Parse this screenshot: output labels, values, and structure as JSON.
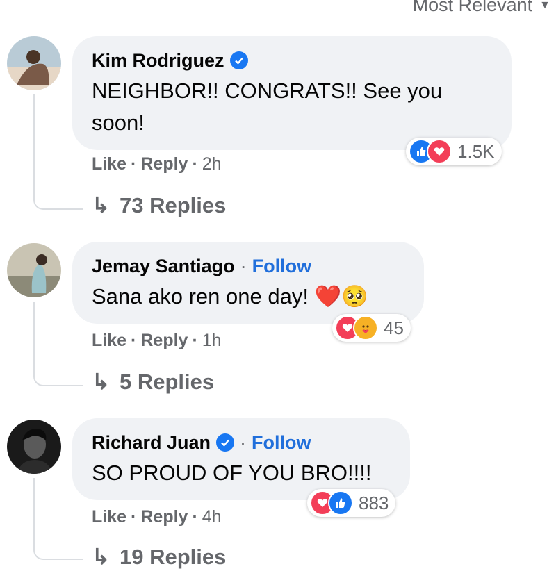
{
  "sort_label": "Most Relevant",
  "comments": [
    {
      "name": "Kim Rodriguez",
      "verified": true,
      "follow": "",
      "text": "NEIGHBOR!! CONGRATS!! See you soon!",
      "reactions": [
        "like",
        "love"
      ],
      "reaction_count": "1.5K",
      "like": "Like",
      "reply": "Reply",
      "time": "2h",
      "replies": "73 Replies"
    },
    {
      "name": "Jemay Santiago",
      "verified": false,
      "follow": "Follow",
      "text": "Sana ako ren one day! ❤️🥺",
      "reactions": [
        "love",
        "care"
      ],
      "reaction_count": "45",
      "like": "Like",
      "reply": "Reply",
      "time": "1h",
      "replies": "5 Replies"
    },
    {
      "name": "Richard Juan",
      "verified": true,
      "follow": "Follow",
      "text": "SO PROUD OF YOU BRO!!!!",
      "reactions": [
        "love",
        "like"
      ],
      "reaction_count": "883",
      "like": "Like",
      "reply": "Reply",
      "time": "4h",
      "replies": "19 Replies"
    }
  ],
  "sep_dot": "·",
  "colors": {
    "like": "#1877f2",
    "love": "#f33e58",
    "care": "#f7b125",
    "link": "#216fdb"
  }
}
